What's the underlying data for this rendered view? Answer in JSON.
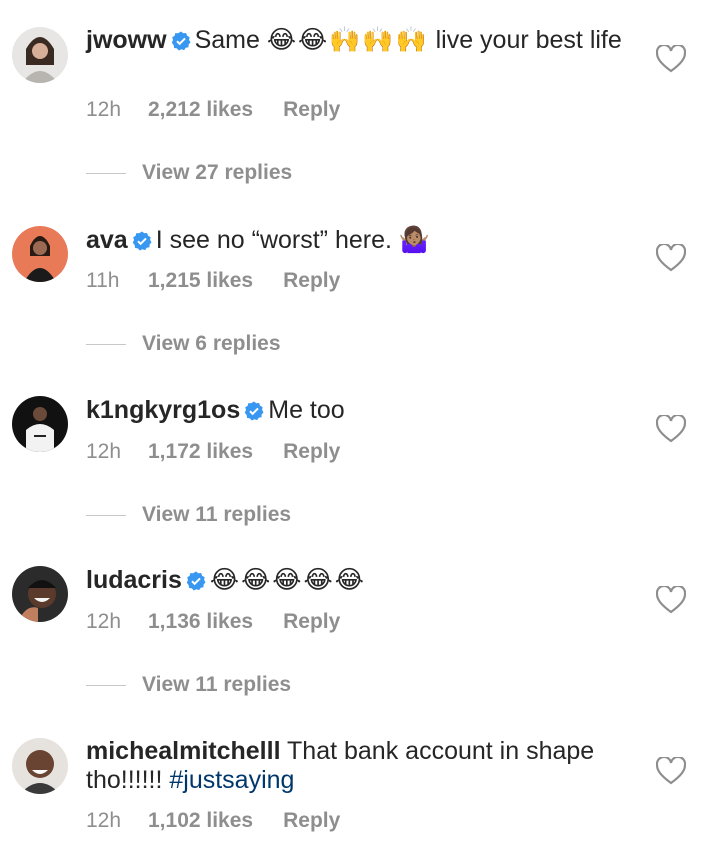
{
  "comments": [
    {
      "username": "jwoww",
      "text_segments": [
        "Same ",
        "😂😂🙌🙌🙌",
        " live your best life"
      ],
      "time": "12h",
      "likes": "2,212 likes",
      "reply": "Reply",
      "view_replies": "View 27 replies",
      "verified": true
    },
    {
      "username": "ava",
      "text_segments": [
        "I see no “worst” here. ",
        "🤷🏽‍♀️"
      ],
      "time": "11h",
      "likes": "1,215 likes",
      "reply": "Reply",
      "view_replies": "View 6 replies",
      "verified": true
    },
    {
      "username": "k1ngkyrg1os",
      "text_segments": [
        "Me too"
      ],
      "time": "12h",
      "likes": "1,172 likes",
      "reply": "Reply",
      "view_replies": "View 11 replies",
      "verified": true
    },
    {
      "username": "ludacris",
      "text_segments": [
        "😂😂😂😂😂"
      ],
      "time": "12h",
      "likes": "1,136 likes",
      "reply": "Reply",
      "view_replies": "View 11 replies",
      "verified": true
    },
    {
      "username": "michealmitchelll",
      "text_segments": [
        "That bank account in shape tho!!!!!! ",
        "#justsaying"
      ],
      "time": "12h",
      "likes": "1,102 likes",
      "reply": "Reply",
      "verified": false
    }
  ],
  "icons": {
    "verified": "verified-badge-icon",
    "like": "heart-outline-icon"
  },
  "colors": {
    "text": "#262626",
    "secondary": "#8e8e8e",
    "verified": "#3897f0",
    "hashtag": "#00376b"
  }
}
